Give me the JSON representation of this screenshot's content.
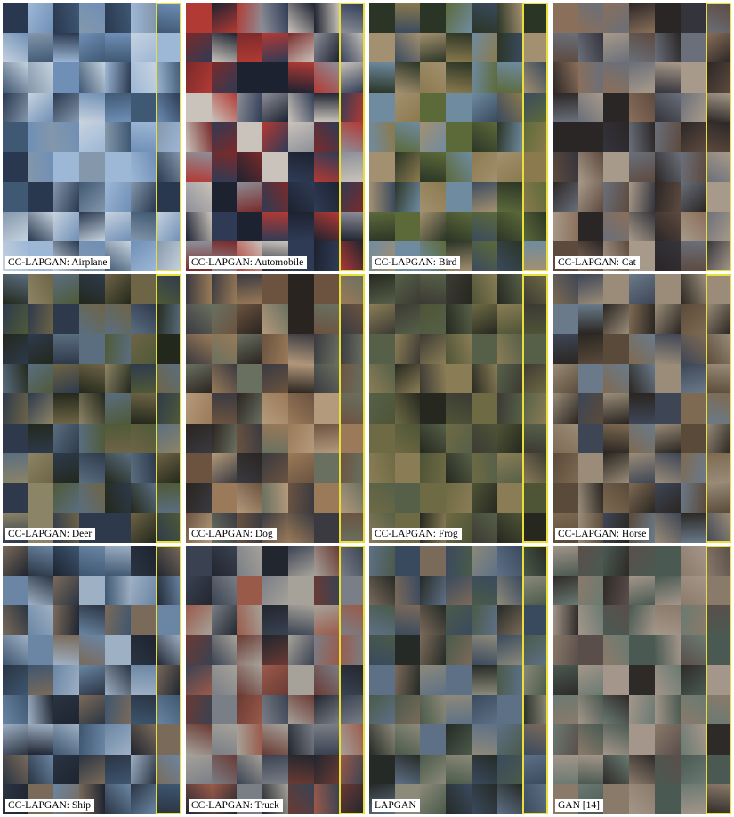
{
  "figure": {
    "panels": [
      {
        "label": "CC-LAPGAN: Airplane",
        "palette": [
          "#6f8fb6",
          "#9db7d6",
          "#3f5873",
          "#c7d3df",
          "#29384f",
          "#8497ab"
        ]
      },
      {
        "label": "CC-LAPGAN: Automobile",
        "palette": [
          "#7a2a2a",
          "#b23a34",
          "#2f3b55",
          "#8d8f98",
          "#1d2230",
          "#c9c3bb"
        ]
      },
      {
        "label": "CC-LAPGAN: Bird",
        "palette": [
          "#5c6a3a",
          "#8a7a4e",
          "#3a4a5e",
          "#a39070",
          "#2b3526",
          "#6f8ba0"
        ]
      },
      {
        "label": "CC-LAPGAN: Cat",
        "palette": [
          "#5d4a3f",
          "#8a6f5a",
          "#34343c",
          "#a89a8a",
          "#2b2626",
          "#6a6f7a"
        ]
      },
      {
        "label": "CC-LAPGAN: Deer",
        "palette": [
          "#4f5a38",
          "#6e6446",
          "#2e3a4c",
          "#8c8466",
          "#23281c",
          "#5a6e80"
        ]
      },
      {
        "label": "CC-LAPGAN: Dog",
        "palette": [
          "#6b5340",
          "#9a7a58",
          "#3a3a40",
          "#b49a7c",
          "#2a2420",
          "#6a7060"
        ]
      },
      {
        "label": "CC-LAPGAN: Frog",
        "palette": [
          "#4e5436",
          "#6e6a44",
          "#3c3a34",
          "#8a7d56",
          "#262820",
          "#566048"
        ]
      },
      {
        "label": "CC-LAPGAN: Horse",
        "palette": [
          "#5a4a3a",
          "#7e6a52",
          "#3e4656",
          "#9a8c78",
          "#2a2622",
          "#6a7a8a"
        ]
      },
      {
        "label": "CC-LAPGAN: Ship",
        "palette": [
          "#3e5670",
          "#6a86a4",
          "#2a3442",
          "#9eb0c4",
          "#1e2430",
          "#7a6a5a"
        ]
      },
      {
        "label": "CC-LAPGAN: Truck",
        "palette": [
          "#6a3a34",
          "#9a5a4a",
          "#3a4252",
          "#a6a29a",
          "#22262e",
          "#7a7e86"
        ]
      },
      {
        "label": "LAPGAN",
        "palette": [
          "#4a5a4a",
          "#7a6a5a",
          "#3a4a5e",
          "#8c8a7a",
          "#252a26",
          "#5e7086"
        ]
      },
      {
        "label": "GAN [14]",
        "palette": [
          "#5a4e4a",
          "#8a7a6a",
          "#4a5a52",
          "#a4968a",
          "#2e2a28",
          "#6a7a72"
        ]
      }
    ]
  }
}
